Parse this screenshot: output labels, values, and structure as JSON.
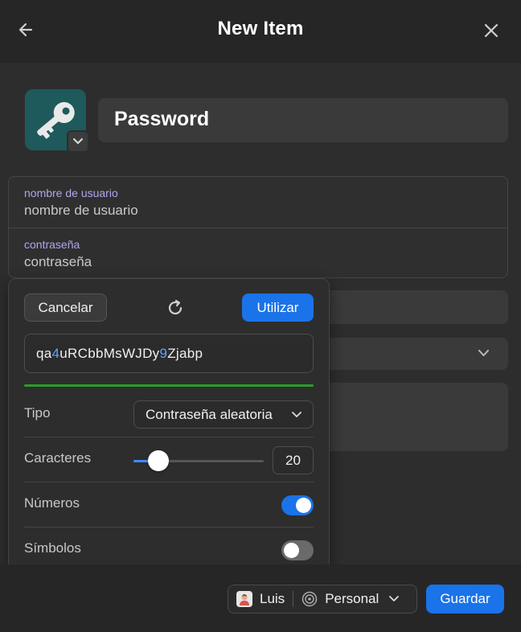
{
  "header": {
    "title": "New Item",
    "back_icon": "arrow-left-icon",
    "close_icon": "close-icon"
  },
  "item": {
    "icon": "key-icon",
    "title": "Password"
  },
  "fields": [
    {
      "label": "nombre de usuario",
      "placeholder": "nombre de usuario"
    },
    {
      "label": "contraseña",
      "placeholder": "contraseña"
    }
  ],
  "generator": {
    "cancel_label": "Cancelar",
    "use_label": "Utilizar",
    "refresh_icon": "refresh-icon",
    "password_parts": [
      "qa",
      "4",
      "uRCbbMsWJDy",
      "9",
      "Zjabp"
    ],
    "strength_color": "#2a9d2a",
    "type_label": "Tipo",
    "type_value": "Contraseña aleatoria",
    "chars_label": "Caracteres",
    "chars_value": "20",
    "chars_level": 0.19,
    "numbers_label": "Números",
    "numbers_on": true,
    "symbols_label": "Símbolos",
    "symbols_on": false
  },
  "footer": {
    "user_name": "Luis",
    "vault_name": "Personal",
    "save_label": "Guardar"
  },
  "colors": {
    "accent": "#1a73e8",
    "field_label": "#b5a4f0",
    "icon_bg": "#1e5a5b"
  }
}
